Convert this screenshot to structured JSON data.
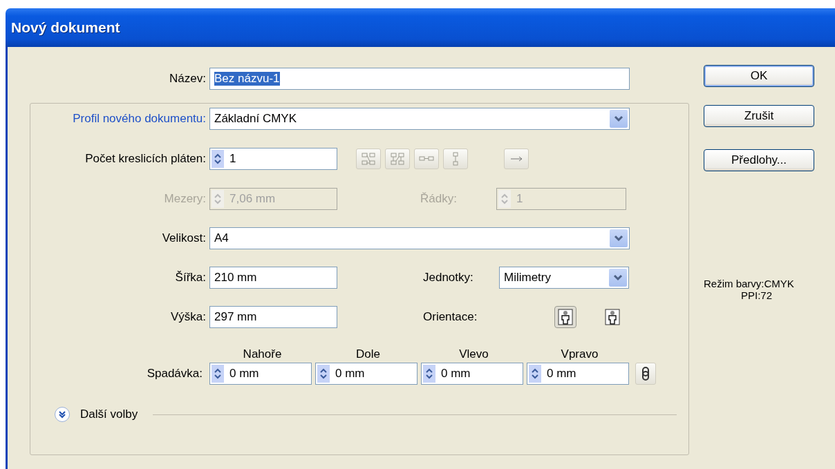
{
  "window": {
    "title": "Nový dokument"
  },
  "name": {
    "label": "Název:",
    "value": "Bez názvu-1",
    "text_selected": true
  },
  "profile": {
    "label": "Profil nového dokumentu:",
    "value": "Základní CMYK"
  },
  "artboards": {
    "label": "Počet kreslicích pláten:",
    "value": "1",
    "disabled": false
  },
  "spacing": {
    "label": "Mezery:",
    "value": "7,06 mm",
    "disabled": true
  },
  "rows": {
    "label": "Řádky:",
    "value": "1",
    "disabled": true
  },
  "size": {
    "label": "Velikost:",
    "value": "A4"
  },
  "width": {
    "label": "Šířka:",
    "value": "210 mm"
  },
  "units": {
    "label": "Jednotky:",
    "value": "Milimetry"
  },
  "height": {
    "label": "Výška:",
    "value": "297 mm"
  },
  "orientation": {
    "label": "Orientace:",
    "options": [
      {
        "selected": true
      },
      {
        "selected": false
      }
    ]
  },
  "bleed": {
    "label": "Spadávka:",
    "fields": [
      {
        "heading": "Nahoře",
        "value": "0 mm"
      },
      {
        "heading": "Dole",
        "value": "0 mm"
      },
      {
        "heading": "Vlevo",
        "value": "0 mm"
      },
      {
        "heading": "Vpravo",
        "value": "0 mm"
      }
    ]
  },
  "more_options": {
    "label": "Další volby",
    "expanded": false
  },
  "buttons": [
    {
      "label": "OK",
      "default": true
    },
    {
      "label": "Zrušit",
      "default": false
    },
    {
      "label": "Předlohy...",
      "default": false
    }
  ],
  "info": [
    "Režim barvy:CMYK",
    "PPI:72"
  ]
}
